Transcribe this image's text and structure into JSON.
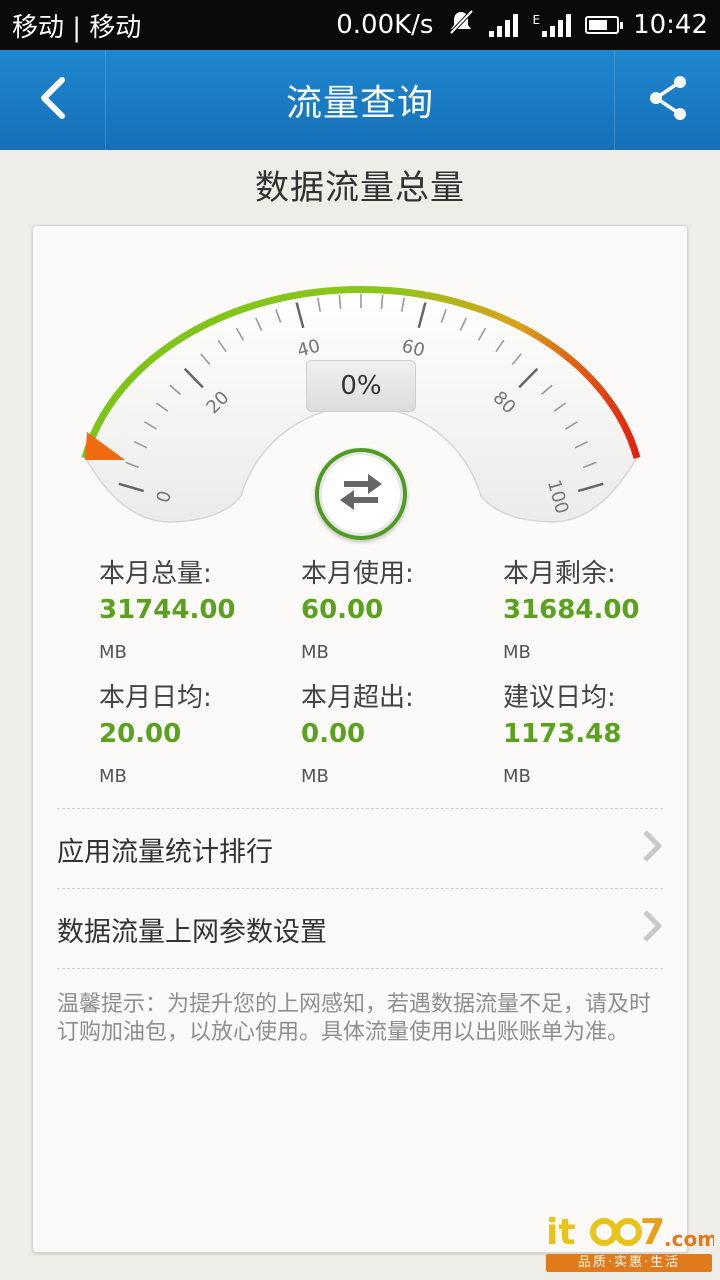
{
  "status_bar": {
    "carriers": "移动 | 移动",
    "speed": "0.00K/s",
    "network_type": "E",
    "time": "10:42"
  },
  "app_bar": {
    "title": "流量查询",
    "back_icon": "chevron-left-icon",
    "share_icon": "share-icon"
  },
  "page_title": "数据流量总量",
  "gauge": {
    "percent_text": "0%",
    "percent_value": 0,
    "ticks": [
      "0",
      "20",
      "40",
      "60",
      "80",
      "100"
    ],
    "colors": {
      "low": "#7bc417",
      "mid": "#d9a21a",
      "high": "#e31f10"
    }
  },
  "stats": [
    {
      "label": "本月总量:",
      "value": "31744.00",
      "unit": "MB"
    },
    {
      "label": "本月使用:",
      "value": "60.00",
      "unit": "MB"
    },
    {
      "label": "本月剩余:",
      "value": "31684.00",
      "unit": "MB"
    },
    {
      "label": "本月日均:",
      "value": "20.00",
      "unit": "MB"
    },
    {
      "label": "本月超出:",
      "value": "0.00",
      "unit": "MB"
    },
    {
      "label": "建议日均:",
      "value": "1173.48",
      "unit": "MB"
    }
  ],
  "menu": [
    {
      "label": "应用流量统计排行"
    },
    {
      "label": "数据流量上网参数设置"
    }
  ],
  "tip": "温馨提示：为提升您的上网感知，若遇数据流量不足，请及时订购加油包，以放心使用。具体流量使用以出账账单为准。",
  "watermark": {
    "tagline": "品质·实惠·生活"
  },
  "accent_color": "#1a7dc6",
  "value_color": "#5aa21d"
}
